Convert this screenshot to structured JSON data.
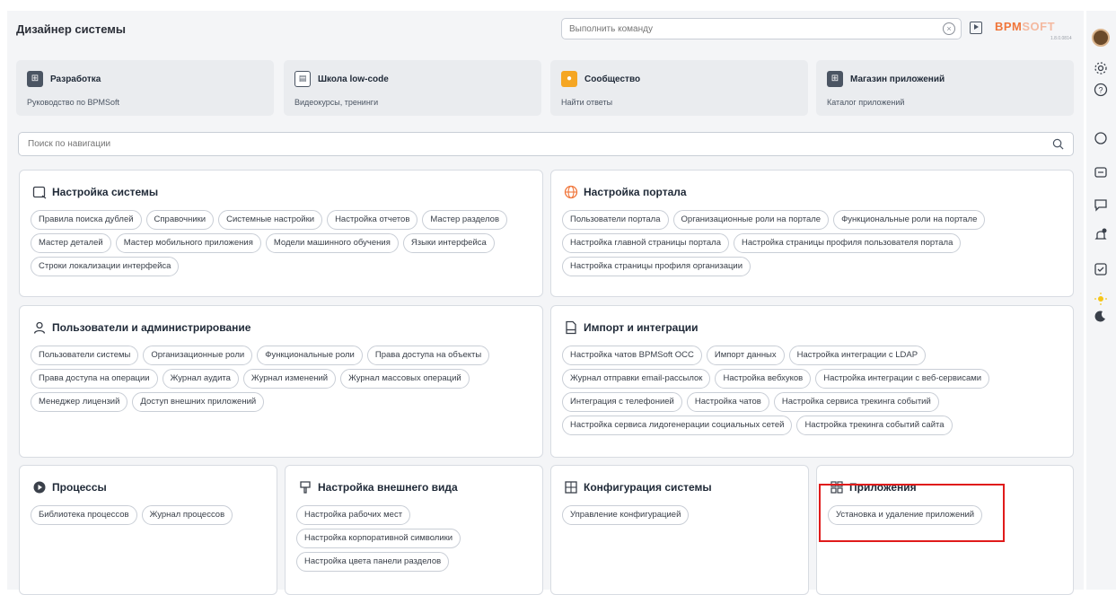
{
  "header": {
    "title": "Дизайнер системы",
    "command_placeholder": "Выполнить команду",
    "logo_part1": "BPM",
    "logo_part2": "SOFT",
    "version": "1.8.0.0814"
  },
  "quick_cards": [
    {
      "title": "Разработка",
      "subtitle": "Руководство по BPMSoft",
      "icon": "dev-icon",
      "color": "#4b5563"
    },
    {
      "title": "Школа low-code",
      "subtitle": "Видеокурсы, тренинги",
      "icon": "school-icon",
      "color": "#4b5563"
    },
    {
      "title": "Сообщество",
      "subtitle": "Найти ответы",
      "icon": "community-icon",
      "color": "#f5a623"
    },
    {
      "title": "Магазин приложений",
      "subtitle": "Каталог приложений",
      "icon": "store-icon",
      "color": "#4b5563"
    }
  ],
  "search": {
    "placeholder": "Поиск по навигации"
  },
  "sections": {
    "system": {
      "title": "Настройка системы",
      "items": [
        "Правила поиска дублей",
        "Справочники",
        "Системные настройки",
        "Настройка отчетов",
        "Мастер разделов",
        "Мастер деталей",
        "Мастер мобильного приложения",
        "Модели машинного обучения",
        "Языки интерфейса",
        "Строки локализации интерфейса"
      ]
    },
    "portal": {
      "title": "Настройка портала",
      "items": [
        "Пользователи портала",
        "Организационные роли на портале",
        "Функциональные роли на портале",
        "Настройка главной страницы портала",
        "Настройка страницы профиля пользователя портала",
        "Настройка страницы профиля организации"
      ]
    },
    "users": {
      "title": "Пользователи и администрирование",
      "items": [
        "Пользователи системы",
        "Организационные роли",
        "Функциональные роли",
        "Права доступа на объекты",
        "Права доступа на операции",
        "Журнал аудита",
        "Журнал изменений",
        "Журнал массовых операций",
        "Менеджер лицензий",
        "Доступ внешних приложений"
      ]
    },
    "import": {
      "title": "Импорт и интеграции",
      "items": [
        "Настройка чатов BPMSoft OCC",
        "Импорт данных",
        "Настройка интеграции с LDAP",
        "Журнал отправки email-рассылок",
        "Настройка вебхуков",
        "Настройка интеграции с веб-сервисами",
        "Интеграция с телефонией",
        "Настройка чатов",
        "Настройка сервиса трекинга событий",
        "Настройка сервиса лидогенерации социальных сетей",
        "Настройка трекинга событий сайта"
      ]
    },
    "processes": {
      "title": "Процессы",
      "items": [
        "Библиотека процессов",
        "Журнал процессов"
      ]
    },
    "appearance": {
      "title": "Настройка внешнего вида",
      "items": [
        "Настройка рабочих мест",
        "Настройка корпоративной символики",
        "Настройка цвета панели разделов"
      ]
    },
    "config": {
      "title": "Конфигурация системы",
      "items": [
        "Управление конфигурацией"
      ]
    },
    "apps": {
      "title": "Приложения",
      "items": [
        "Установка и удаление приложений"
      ]
    }
  },
  "colors": {
    "accent": "#f0763b",
    "highlight": "#e01b1b",
    "portal_icon": "#f0763b"
  }
}
